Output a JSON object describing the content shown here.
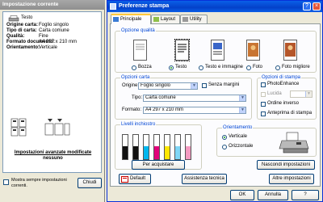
{
  "left_window": {
    "title": "Impostazione corrente",
    "printer_name": "Testo",
    "rows": [
      {
        "key": "Origine carta:",
        "value": "Foglio singolo"
      },
      {
        "key": "Tipo di carta:",
        "value": "Carta comune"
      },
      {
        "key": "Qualità:",
        "value": "Fine"
      },
      {
        "key": "Formato documento:",
        "value": "A4 297 x 210 mm"
      },
      {
        "key": "Orientamento:",
        "value": "Verticale"
      }
    ],
    "advanced_title": "Impostazioni avanzate modificate",
    "advanced_value": "nessuno",
    "always_show_label": "Mostra sempre impostazioni correnti.",
    "close_label": "Chiudi"
  },
  "dialog": {
    "title": "Preferenze stampa",
    "tabs": [
      {
        "label": "Principale",
        "active": true
      },
      {
        "label": "Layout",
        "active": false
      },
      {
        "label": "Utility",
        "active": false
      }
    ],
    "quality": {
      "group_label": "Opzione qualità",
      "options": [
        {
          "label": "Bozza",
          "selected": false
        },
        {
          "label": "Testo",
          "selected": true
        },
        {
          "label": "Testo e immagine",
          "selected": false
        },
        {
          "label": "Foto",
          "selected": false
        },
        {
          "label": "Foto migliore",
          "selected": false
        }
      ]
    },
    "paper": {
      "group_label": "Opzioni carta",
      "source_label": "Origine:",
      "source_value": "Foglio singolo",
      "borderless_label": "Senza margini",
      "type_label": "Tipo:",
      "type_value": "Carta comune",
      "size_label": "Formato:",
      "size_value": "A4 297 x 210 mm"
    },
    "print_options": {
      "group_label": "Opzioni di stampa",
      "items": [
        {
          "label": "PhotoEnhance",
          "enabled": true,
          "checked": false
        },
        {
          "label": "Lucida",
          "enabled": false,
          "checked": false
        },
        {
          "label": "Ordine inverso",
          "enabled": true,
          "checked": false
        },
        {
          "label": "Anteprima di stampa",
          "enabled": true,
          "checked": false
        }
      ]
    },
    "ink": {
      "group_label": "Livelli inchiostro",
      "levels": [
        {
          "color": "#111111",
          "level": 0.55
        },
        {
          "color": "#111111",
          "level": 0.55
        },
        {
          "color": "#00b7ef",
          "level": 0.55
        },
        {
          "color": "#e2007a",
          "level": 0.55
        },
        {
          "color": "#ffe600",
          "level": 0.55
        },
        {
          "color": "#7fd6f6",
          "level": 0.55
        },
        {
          "color": "#f49ac1",
          "level": 0.55
        }
      ],
      "buy_label": "Per acquistare"
    },
    "orientation": {
      "group_label": "Orientamento",
      "options": [
        {
          "label": "Verticale",
          "selected": true
        },
        {
          "label": "Orizzontale",
          "selected": false
        }
      ]
    },
    "buttons": {
      "default": "Default",
      "tech_support": "Assistenza tecnica",
      "show_settings": "Nascondi impostazioni",
      "other_settings": "Altre impostazioni",
      "ok": "OK",
      "cancel": "Annulla",
      "help": "?"
    }
  }
}
